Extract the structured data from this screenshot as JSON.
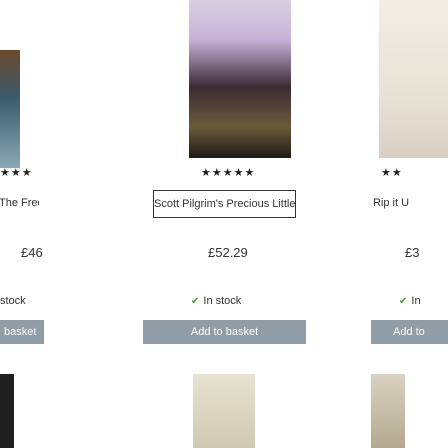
{
  "products": [
    {
      "rating_stars": "★★★",
      "title": "The Free",
      "price": "£46",
      "stock": "stock",
      "button": "basket"
    },
    {
      "rating_stars": "★★★★★",
      "title": "Scott Pilgrim's Precious Little",
      "price": "£52.29",
      "stock": "In stock",
      "button": "Add to basket"
    },
    {
      "rating_stars": "★★",
      "title": "Rip it U",
      "price": "£3",
      "stock": "In",
      "button": "Add to"
    }
  ],
  "icons": {
    "stock": "check-icon",
    "rating": "star-icon"
  },
  "colors": {
    "button_bg": "#909ca6",
    "button_text": "#ffffff",
    "in_stock": "#3a9a3a"
  }
}
